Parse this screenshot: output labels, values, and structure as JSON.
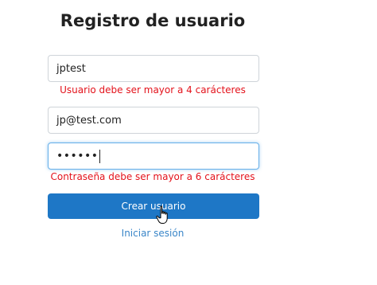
{
  "form": {
    "title": "Registro de usuario",
    "username": {
      "value": "jptest",
      "error": "Usuario debe ser mayor a 4 carácteres"
    },
    "email": {
      "value": "jp@test.com"
    },
    "password": {
      "masked_value": "••••••",
      "error": "Contraseña debe ser mayor a 6 carácteres"
    },
    "submit_label": "Crear usuario",
    "login_link": "Iniciar sesión"
  },
  "colors": {
    "primary_button": "#1e77c6",
    "error_text": "#e3121b",
    "link_text": "#3a86c8",
    "focus_border": "#66afe9"
  },
  "icons": {
    "cursor": "hand-pointer-icon"
  }
}
